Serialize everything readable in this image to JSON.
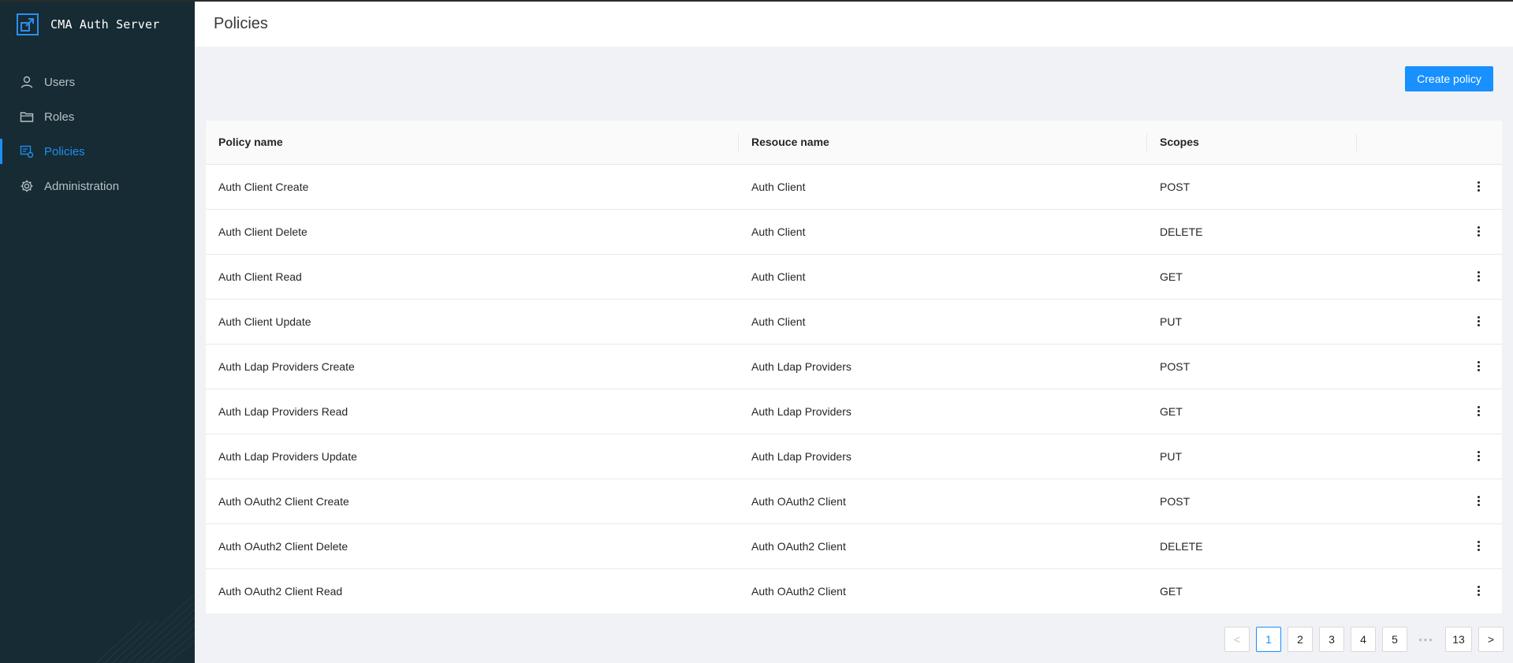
{
  "app": {
    "title": "CMA Auth Server",
    "logo_icon": "app-logo-icon"
  },
  "nav": {
    "items": [
      {
        "label": "Users",
        "icon": "user-icon",
        "active": false
      },
      {
        "label": "Roles",
        "icon": "folder-icon",
        "active": false
      },
      {
        "label": "Policies",
        "icon": "policy-icon",
        "active": true
      },
      {
        "label": "Administration",
        "icon": "gear-icon",
        "active": false
      }
    ]
  },
  "header": {
    "title": "Policies"
  },
  "toolbar": {
    "create_label": "Create policy"
  },
  "table": {
    "columns": [
      "Policy name",
      "Resouce name",
      "Scopes",
      ""
    ],
    "rows": [
      {
        "name": "Auth Client Create",
        "resource": "Auth Client",
        "scope": "POST"
      },
      {
        "name": "Auth Client Delete",
        "resource": "Auth Client",
        "scope": "DELETE"
      },
      {
        "name": "Auth Client Read",
        "resource": "Auth Client",
        "scope": "GET"
      },
      {
        "name": "Auth Client Update",
        "resource": "Auth Client",
        "scope": "PUT"
      },
      {
        "name": "Auth Ldap Providers Create",
        "resource": "Auth Ldap Providers",
        "scope": "POST"
      },
      {
        "name": "Auth Ldap Providers Read",
        "resource": "Auth Ldap Providers",
        "scope": "GET"
      },
      {
        "name": "Auth Ldap Providers Update",
        "resource": "Auth Ldap Providers",
        "scope": "PUT"
      },
      {
        "name": "Auth OAuth2 Client Create",
        "resource": "Auth OAuth2 Client",
        "scope": "POST"
      },
      {
        "name": "Auth OAuth2 Client Delete",
        "resource": "Auth OAuth2 Client",
        "scope": "DELETE"
      },
      {
        "name": "Auth OAuth2 Client Read",
        "resource": "Auth OAuth2 Client",
        "scope": "GET"
      }
    ]
  },
  "pagination": {
    "pages": [
      "1",
      "2",
      "3",
      "4",
      "5"
    ],
    "ellipsis": "•••",
    "last": "13",
    "current": "1",
    "prev_icon": "<",
    "next_icon": ">"
  },
  "colors": {
    "sidebar_bg": "#162b33",
    "accent": "#1890ff",
    "page_bg": "#f0f2f5"
  }
}
